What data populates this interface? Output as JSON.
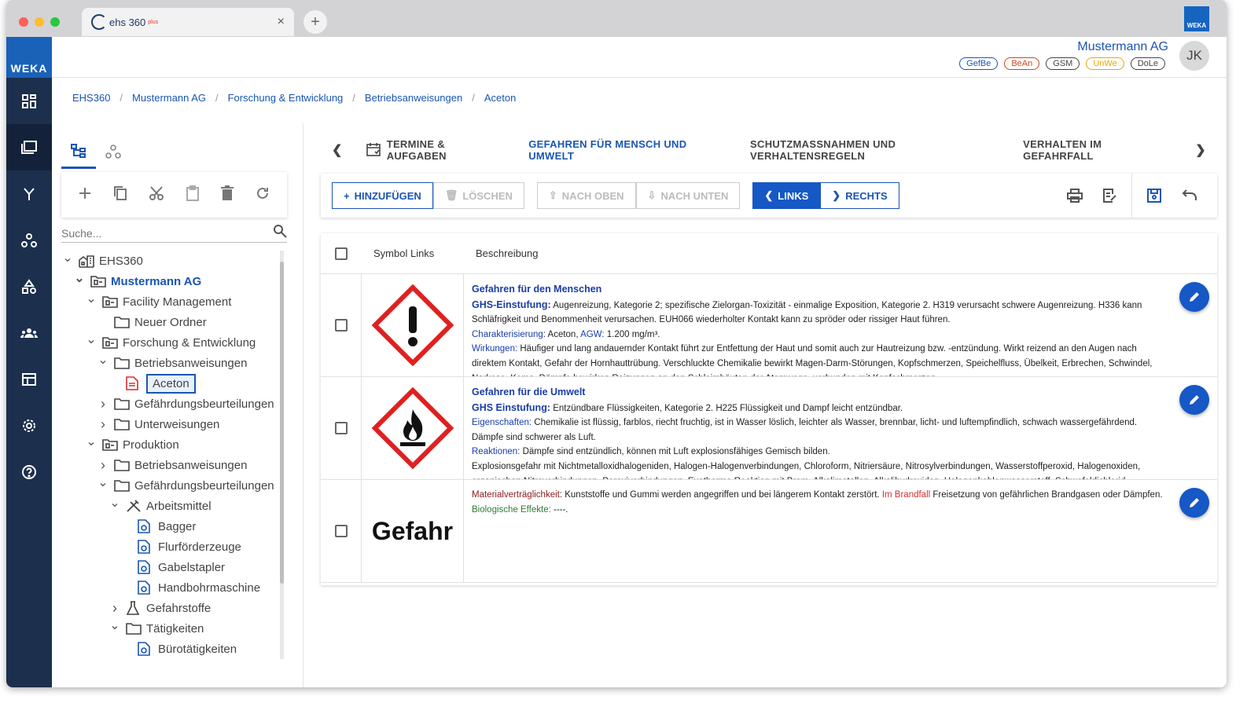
{
  "browser": {
    "tab_title": "ehs 360",
    "tab_title_sup": "plus",
    "close": "×",
    "new_tab": "+"
  },
  "brand": {
    "logo": "WEKA",
    "corner_logo": "WEKA"
  },
  "colors": {
    "brand": "#1a55b3",
    "rail": "#1c2f4d",
    "primary_button": "#1558c6",
    "hazard_red": "#e53935"
  },
  "header": {
    "company": "Mustermann AG",
    "avatar": "JK",
    "chips": [
      {
        "label": "GefBe",
        "color": "#1a55b3"
      },
      {
        "label": "BeAn",
        "color": "#d84315"
      },
      {
        "label": "GSM",
        "color": "#444"
      },
      {
        "label": "UnWe",
        "color": "#e6a700"
      },
      {
        "label": "DoLe",
        "color": "#444"
      }
    ]
  },
  "breadcrumb": [
    "EHS360",
    "Mustermann AG",
    "Forschung & Entwicklung",
    "Betriebsanweisungen",
    "Aceton"
  ],
  "sidebar": {
    "search_placeholder": "Suche...",
    "tree": [
      {
        "label": "EHS360",
        "depth": 0,
        "chev": "v",
        "icon": "building"
      },
      {
        "label": "Mustermann AG",
        "depth": 1,
        "chev": "v",
        "icon": "folder-org",
        "bold": true
      },
      {
        "label": "Facility Management",
        "depth": 2,
        "chev": "v",
        "icon": "folder-org"
      },
      {
        "label": "Neuer Ordner",
        "depth": 3,
        "chev": "",
        "icon": "folder"
      },
      {
        "label": "Forschung & Entwicklung",
        "depth": 2,
        "chev": "v",
        "icon": "folder-org"
      },
      {
        "label": "Betriebsanweisungen",
        "depth": 3,
        "chev": "v",
        "icon": "folder"
      },
      {
        "label": "Aceton",
        "depth": 4,
        "chev": "",
        "icon": "doc-red",
        "selected": true
      },
      {
        "label": "Gefährdungsbeurteilungen",
        "depth": 3,
        "chev": ">",
        "icon": "folder"
      },
      {
        "label": "Unterweisungen",
        "depth": 3,
        "chev": ">",
        "icon": "folder"
      },
      {
        "label": "Produktion",
        "depth": 2,
        "chev": "v",
        "icon": "folder-org"
      },
      {
        "label": "Betriebsanweisungen",
        "depth": 3,
        "chev": ">",
        "icon": "folder"
      },
      {
        "label": "Gefährdungsbeurteilungen",
        "depth": 3,
        "chev": "v",
        "icon": "folder"
      },
      {
        "label": "Arbeitsmittel",
        "depth": 4,
        "chev": "v",
        "icon": "tools"
      },
      {
        "label": "Bagger",
        "depth": 5,
        "chev": "",
        "icon": "doc-blue"
      },
      {
        "label": "Flurförderzeuge",
        "depth": 5,
        "chev": "",
        "icon": "doc-blue"
      },
      {
        "label": "Gabelstapler",
        "depth": 5,
        "chev": "",
        "icon": "doc-blue"
      },
      {
        "label": "Handbohrmaschine",
        "depth": 5,
        "chev": "",
        "icon": "doc-blue"
      },
      {
        "label": "Gefahrstoffe",
        "depth": 4,
        "chev": ">",
        "icon": "flask"
      },
      {
        "label": "Tätigkeiten",
        "depth": 4,
        "chev": "v",
        "icon": "folder"
      },
      {
        "label": "Bürotätigkeiten",
        "depth": 5,
        "chev": "",
        "icon": "doc-blue"
      }
    ]
  },
  "section_tabs": {
    "items": [
      {
        "label": "TERMINE & AUFGABEN",
        "icon": "calendar-icon",
        "active": false
      },
      {
        "label": "GEFAHREN FÜR MENSCH UND UMWELT",
        "active": true
      },
      {
        "label": "SCHUTZMASSNAHMEN UND VERHALTENSREGELN",
        "active": false
      },
      {
        "label": "VERHALTEN IM GEFAHRFALL",
        "active": false
      }
    ]
  },
  "toolbar": {
    "add": "HINZUFÜGEN",
    "delete": "LÖSCHEN",
    "up": "NACH OBEN",
    "down": "NACH UNTEN",
    "left": "LINKS",
    "right": "RECHTS"
  },
  "table": {
    "headers": {
      "symbol": "Symbol Links",
      "description": "Beschreibung"
    },
    "rows": [
      {
        "symbol": "exclamation",
        "lines": [
          [
            {
              "t": "Gefahren für den Menschen",
              "c": "ttl"
            }
          ],
          [
            {
              "t": "GHS-Einstufung:",
              "c": "ttl"
            },
            {
              "t": " Augenreizung, Kategorie 2; spezifische Zielorgan-Toxizität - einmalige Exposition, Kategorie 2. H319 verursacht schwere Augenreizung. H336 kann Schläfrigkeit und Benommenheit verursachen. EUH066 wiederholter Kontakt kann zu spröder oder rissiger Haut führen.",
              "c": ""
            }
          ],
          [
            {
              "t": "Charakterisierung:",
              "c": "lb"
            },
            {
              "t": " Aceton, ",
              "c": ""
            },
            {
              "t": "AGW:",
              "c": "lb"
            },
            {
              "t": " 1.200 mg/m³.",
              "c": ""
            }
          ],
          [
            {
              "t": "Wirkungen:",
              "c": "lb"
            },
            {
              "t": " Häufiger und lang andauernder Kontakt führt zur Entfettung der Haut und somit auch zur Hautreizung bzw. -entzündung. Wirkt reizend an den Augen nach direktem Kontakt, Gefahr der Hornhauttrübung. Verschluckte Chemikalie bewirkt Magen-Darm-Störungen, Kopfschmerzen, Speichelfluss, Übelkeit, Erbrechen, Schwindel, Narkose, Koma. Dämpfe bewirken Reizungen an den Schleimhäuten der Atemwege, verbunden mit Kopfschmerzen.",
              "c": ""
            }
          ]
        ]
      },
      {
        "symbol": "flame",
        "lines": [
          [
            {
              "t": "Gefahren für die Umwelt",
              "c": "ttl"
            }
          ],
          [
            {
              "t": "GHS Einstufung:",
              "c": "ttl"
            },
            {
              "t": " Entzündbare Flüssigkeiten, Kategorie 2. H225 Flüssigkeit und Dampf leicht entzündbar.",
              "c": ""
            }
          ],
          [
            {
              "t": "Eigenschaften:",
              "c": "lb"
            },
            {
              "t": " Chemikalie ist flüssig, farblos, riecht fruchtig, ist in Wasser löslich, leichter als Wasser, brennbar, licht- und luftempfindlich, schwach wassergefährdend. Dämpfe sind schwerer als Luft.",
              "c": ""
            }
          ],
          [
            {
              "t": "Reaktionen:",
              "c": "lb"
            },
            {
              "t": " Dämpfe sind entzündlich, können mit Luft explosionsfähiges Gemisch bilden.",
              "c": ""
            }
          ],
          [
            {
              "t": "Explosionsgefahr mit Nichtmetalloxidhalogeniden, Halogen-Halogenverbindungen, Chloroform, Nitriersäure, Nitrosylverbindungen, Wasserstoffperoxid, Halogenoxiden, organischen Nitroverbindungen, Peroxiverbindungen. Exotherme Reaktion mit Brom, Alkalimetallen, Alkalihydroxiden, Halogenkohlenwasserstoff, Schwefeldichlorid, Phosphoroxychlorid.",
              "c": ""
            }
          ]
        ]
      },
      {
        "symbol": "Gefahr",
        "lines": [
          [
            {
              "t": "Materialverträglichkeit:",
              "c": "maroon"
            },
            {
              "t": " Kunststoffe und Gummi werden angegriffen und bei längerem Kontakt zerstört. ",
              "c": ""
            },
            {
              "t": "Im Brandfall",
              "c": "red"
            },
            {
              "t": " Freisetzung von gefährlichen Brandgasen oder Dämpfen.",
              "c": ""
            }
          ],
          [
            {
              "t": "Biologische Effekte:",
              "c": "green"
            },
            {
              "t": " ----.",
              "c": ""
            }
          ]
        ]
      }
    ]
  }
}
